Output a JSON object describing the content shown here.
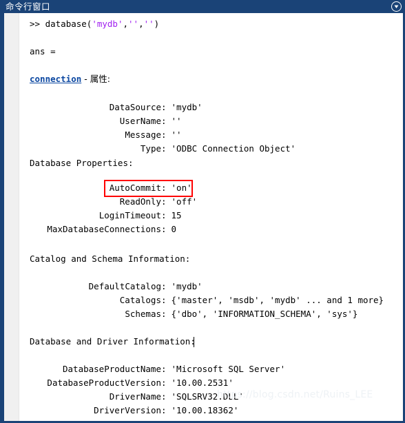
{
  "window": {
    "title": "命令行窗口",
    "collapse_button_icon": "chevron-down-circle-icon",
    "title_bar_color": "#1a4377",
    "background_color": "#ffffff"
  },
  "console": {
    "prompt_symbol": ">>",
    "command": "database('mydb','','')",
    "command_parts": {
      "function_name": "database(",
      "arg1": "'mydb'",
      "sep1": ",",
      "arg2": "''",
      "sep2": ",",
      "arg3": "''",
      "close": ")"
    },
    "ans_label": "ans =",
    "object_link": "connection",
    "object_suffix": " - 属性:",
    "link_color": "#0b47a1",
    "string_color": "#a020f0",
    "caret_visible": true,
    "sections": [
      {
        "heading": null,
        "properties": [
          {
            "label": "DataSource",
            "value": "'mydb'"
          },
          {
            "label": "UserName",
            "value": "''"
          },
          {
            "label": "Message",
            "value": "''"
          },
          {
            "label": "Type",
            "value": "'ODBC Connection Object'"
          }
        ]
      },
      {
        "heading": "Database Properties:",
        "properties": [
          {
            "label": "AutoCommit",
            "value": "'on'",
            "highlighted": true
          },
          {
            "label": "ReadOnly",
            "value": "'off'"
          },
          {
            "label": "LoginTimeout",
            "value": "15"
          },
          {
            "label": "MaxDatabaseConnections",
            "value": "0"
          }
        ]
      },
      {
        "heading": "Catalog and Schema Information:",
        "properties": [
          {
            "label": "DefaultCatalog",
            "value": "'mydb'"
          },
          {
            "label": "Catalogs",
            "value": "{'master', 'msdb', 'mydb' ... and 1 more}"
          },
          {
            "label": "Schemas",
            "value": "{'dbo', 'INFORMATION_SCHEMA', 'sys'}"
          }
        ]
      },
      {
        "heading": "Database and Driver Information:",
        "properties": [
          {
            "label": "DatabaseProductName",
            "value": "'Microsoft SQL Server'"
          },
          {
            "label": "DatabaseProductVersion",
            "value": "'10.00.2531'"
          },
          {
            "label": "DriverName",
            "value": "'SQLSRV32.DLL'"
          },
          {
            "label": "DriverVersion",
            "value": "'10.00.18362'"
          }
        ]
      }
    ]
  },
  "annotation": {
    "box_color": "#ff0000",
    "target_label": "AutoCommit",
    "target_value": "'on'"
  },
  "watermark": {
    "text": "https://blog.csdn.net/Ruins_LEE",
    "color": "#eef2f5"
  }
}
